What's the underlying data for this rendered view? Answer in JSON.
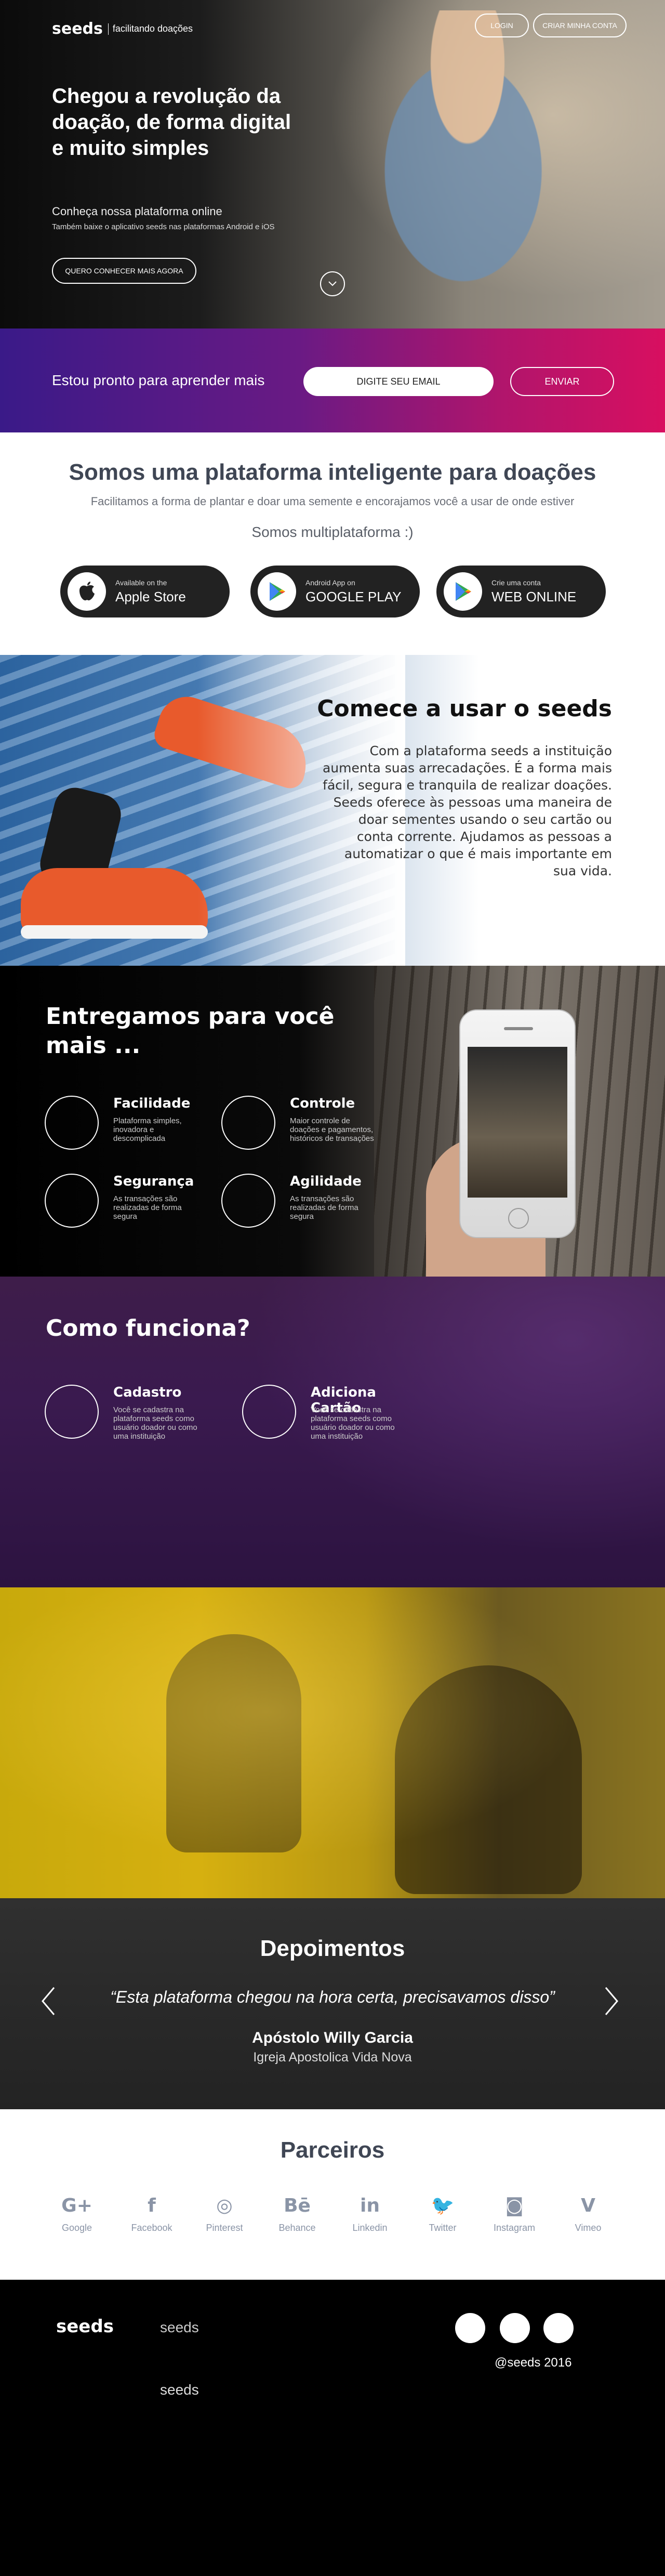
{
  "header": {
    "logo": "seeds",
    "tagline": "facilitando doações",
    "login_label": "LOGIN",
    "signup_label": "CRIAR MINHA CONTA"
  },
  "hero": {
    "title_part1": "Chegou a ",
    "title_bold1": "revolução",
    "title_part2": " da doação, de forma ",
    "title_bold2": "digital e muito simples",
    "subtitle": "Conheça nossa plataforma online",
    "subtitle2": "Também baixe o aplicativo seeds nas plataformas Android e iOS",
    "cta_label": "QUERO CONHECER MAIS AGORA",
    "scroll_icon": "chevron-down-icon"
  },
  "signup_strip": {
    "text": "Estou pronto para aprender mais",
    "email_placeholder": "DIGITE SEU EMAIL",
    "send_label": "ENVIAR"
  },
  "platform": {
    "title_part1": "Somos uma ",
    "title_bold1": "plataforma inteligente",
    "title_part2": " para ",
    "title_bold2": "doações",
    "subtitle": "Facilitamos a forma de plantar e doar uma semente e encorajamos você a usar de onde estiver",
    "multi": "Somos multiplataforma :)",
    "stores": [
      {
        "small": "Available on the",
        "big": "Apple Store",
        "icon": "apple-icon"
      },
      {
        "small": "Android App on",
        "big": "GOOGLE PLAY",
        "icon": "google-play-icon"
      },
      {
        "small": "Crie uma conta",
        "big": "WEB ONLINE",
        "icon": "web-play-icon"
      }
    ]
  },
  "start": {
    "title": "Comece a usar o seeds",
    "body": "Com a plataforma seeds a instituição aumenta  suas arrecadações. É a forma mais fácil, segura e tranquila de realizar doações. Seeds oferece às pessoas uma maneira de doar sementes usando o seu cartão ou conta corrente. Ajudamos as pessoas a automatizar o que é mais importante em sua vida."
  },
  "deliver": {
    "title": "Entregamos para você mais ...",
    "features": [
      {
        "title": "Facilidade",
        "desc": "Plataforma simples, inovadora e descomplicada"
      },
      {
        "title": "Controle",
        "desc": "Maior controle de doações e pagamentos, históricos de transações"
      },
      {
        "title": "Segurança",
        "desc": "As transações são realizadas de forma segura"
      },
      {
        "title": "Agilidade",
        "desc": "As transações são realizadas de forma segura"
      }
    ]
  },
  "how": {
    "title": "Como funciona?",
    "steps": [
      {
        "title": "Cadastro",
        "desc": "Você se cadastra na plataforma seeds como usuário doador ou como uma instituição"
      },
      {
        "title": "Adiciona Cartão",
        "desc": "Você se cadastra na plataforma seeds como usuário doador ou como uma instituição"
      }
    ]
  },
  "testimonials": {
    "title": "Depoimentos",
    "quote": "“Esta plataforma chegou na hora certa, precisavamos disso”",
    "author": "Apóstolo Willy Garcia",
    "organization": "Igreja Apostolica Vida Nova",
    "prev_icon": "chevron-left-icon",
    "next_icon": "chevron-right-icon"
  },
  "partners": {
    "title": "Parceiros",
    "items": [
      {
        "glyph": "G+",
        "label": "Google",
        "icon": "google-plus-icon"
      },
      {
        "glyph": "f",
        "label": "Facebook",
        "icon": "facebook-icon"
      },
      {
        "glyph": "◎",
        "label": "Pinterest",
        "icon": "dribbble-icon"
      },
      {
        "glyph": "Bē",
        "label": "Behance",
        "icon": "behance-icon"
      },
      {
        "glyph": "in",
        "label": "Linkedin",
        "icon": "linkedin-icon"
      },
      {
        "glyph": "🐦",
        "label": "Twitter",
        "icon": "twitter-icon"
      },
      {
        "glyph": "◙",
        "label": "Instagram",
        "icon": "instagram-icon"
      },
      {
        "glyph": "V",
        "label": "Vimeo",
        "icon": "vimeo-icon"
      }
    ]
  },
  "footer": {
    "logo": "seeds",
    "link1": "seeds",
    "link2": "seeds",
    "copyright": "@seeds 2016"
  }
}
